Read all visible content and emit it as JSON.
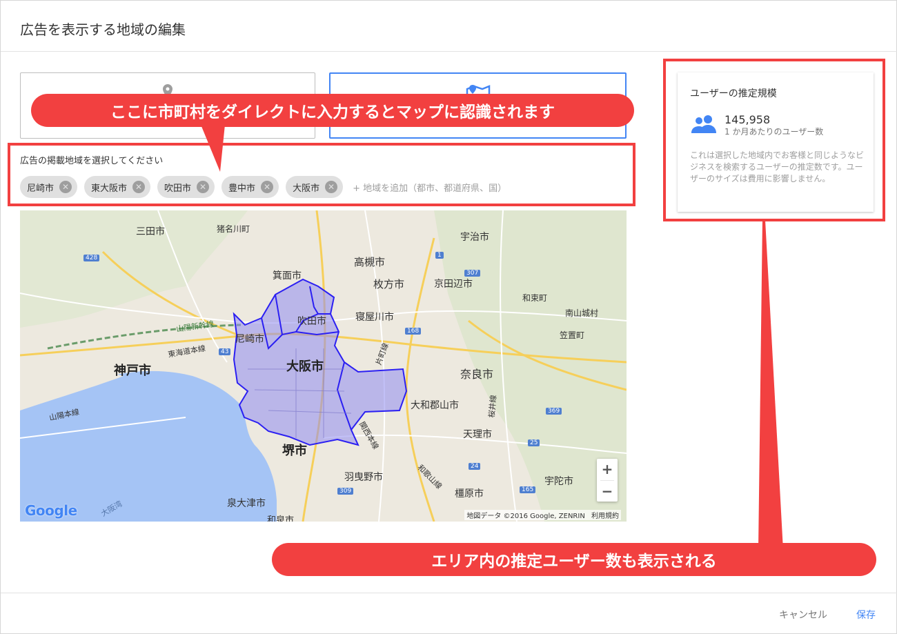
{
  "dialog": {
    "title": "広告を表示する地域の編集"
  },
  "locations": {
    "label": "広告の掲載地域を選択してください",
    "chips": [
      {
        "label": "尼崎市"
      },
      {
        "label": "東大阪市"
      },
      {
        "label": "吹田市"
      },
      {
        "label": "豊中市"
      },
      {
        "label": "大阪市"
      }
    ],
    "add_placeholder": "+ 地域を追加（都市、都道府県、国）"
  },
  "map": {
    "labels": [
      "三田市",
      "猪名川町",
      "宇治市",
      "高槻市",
      "箕面市",
      "枚方市",
      "京田辺市",
      "和束町",
      "吹田市",
      "寝屋川市",
      "南山城村",
      "尼崎市",
      "笠置町",
      "大阪市",
      "神戸市",
      "奈良市",
      "大和郡山市",
      "天理市",
      "堺市",
      "羽曳野市",
      "橿原市",
      "宇陀市",
      "泉大津市",
      "和泉市",
      "山陽新幹線",
      "東海道本線",
      "山陽本線",
      "片町線",
      "関西本線",
      "桜井線",
      "和歌山線",
      "大阪湾"
    ],
    "road_numbers": [
      "428",
      "1",
      "307",
      "168",
      "43",
      "369",
      "25",
      "24",
      "309",
      "165"
    ],
    "google_logo": "Google",
    "attribution": "地図データ ©2016 Google, ZENRIN",
    "terms": "利用規約",
    "zoom_in": "+",
    "zoom_out": "−"
  },
  "reach": {
    "title": "ユーザーの推定規模",
    "value": "145,958",
    "unit": "1 か月あたりのユーザー数",
    "description": "これは選択した地域内でお客様と同じようなビジネスを検索するユーザーの推定数です。ユーザーのサイズは費用に影響しません。"
  },
  "annotations": {
    "top": "ここに市町村をダイレクトに入力するとマップに認識されます",
    "bottom": "エリア内の推定ユーザー数も表示される"
  },
  "footer": {
    "cancel": "キャンセル",
    "save": "保存"
  },
  "colors": {
    "accent": "#4285f4",
    "annotation": "#f24040",
    "region_fill": "#8f8cf0",
    "region_stroke": "#2b1ff2",
    "water": "#a5c4f5"
  }
}
